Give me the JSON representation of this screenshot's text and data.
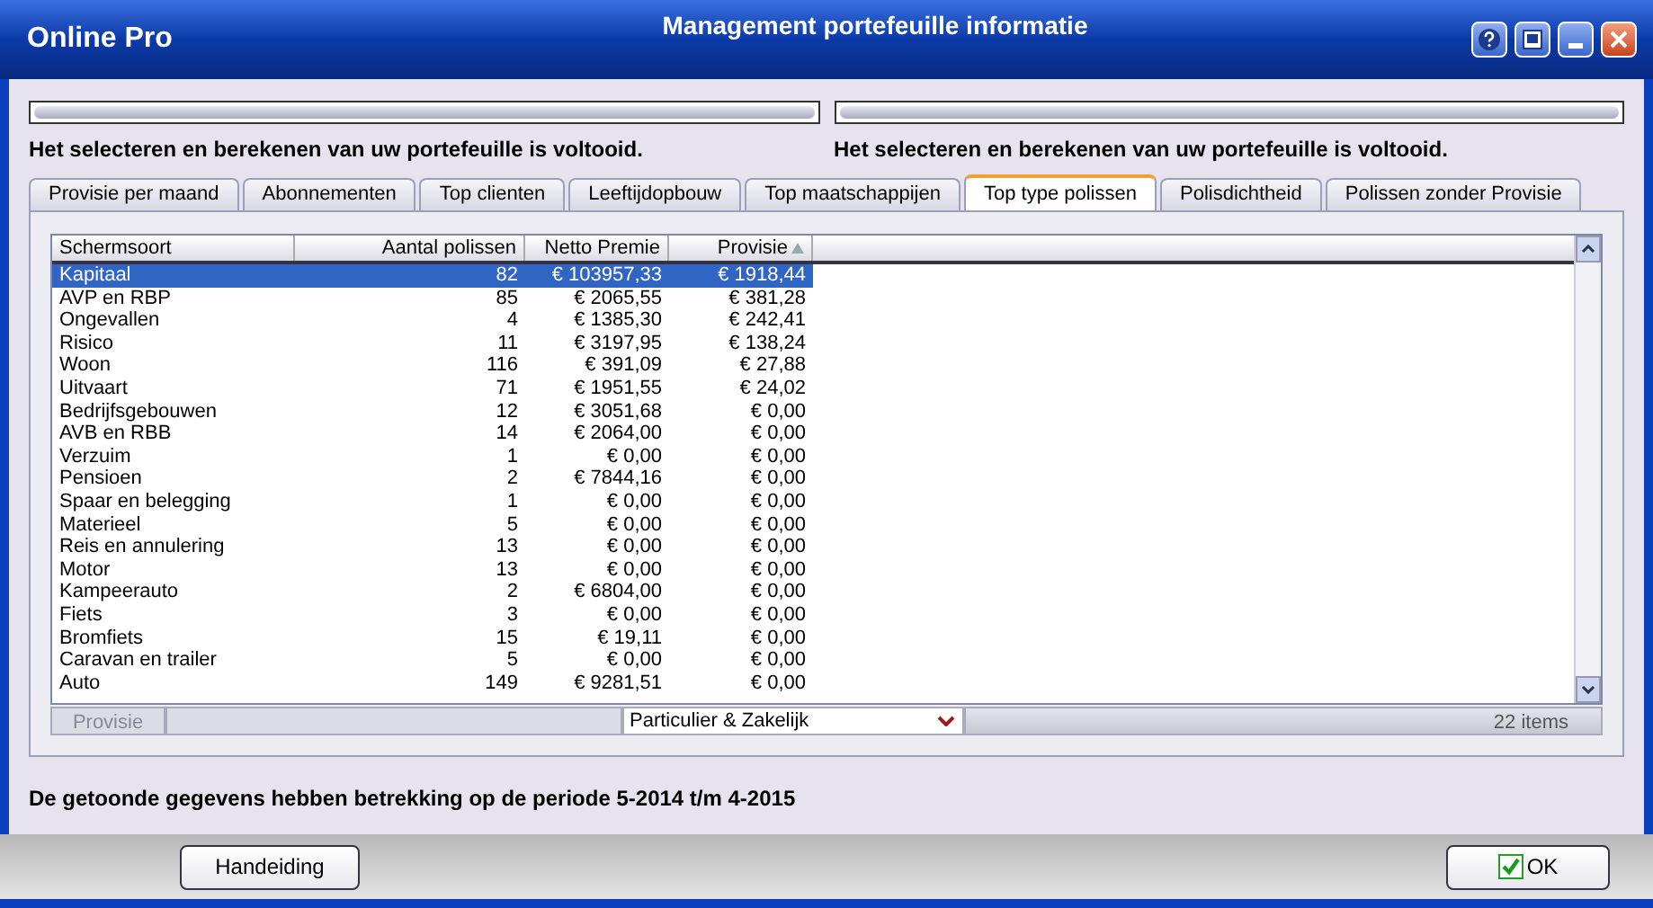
{
  "window": {
    "app_name": "Online Pro",
    "title": "Management portefeuille informatie"
  },
  "progress": [
    {
      "level": 1,
      "message": "Het selecteren en berekenen van uw portefeuille is voltooid."
    },
    {
      "level": 1,
      "message": "Het selecteren en berekenen van uw portefeuille is voltooid."
    }
  ],
  "tabs": [
    {
      "label": "Provisie per maand",
      "selected": false
    },
    {
      "label": "Abonnementen",
      "selected": false
    },
    {
      "label": "Top clienten",
      "selected": false
    },
    {
      "label": "Leeftijdopbouw",
      "selected": false
    },
    {
      "label": "Top maatschappijen",
      "selected": false
    },
    {
      "label": "Top type polissen",
      "selected": true
    },
    {
      "label": "Polisdichtheid",
      "selected": false
    },
    {
      "label": "Polissen zonder Provisie",
      "selected": false
    }
  ],
  "table": {
    "columns": [
      "Schermsoort",
      "Aantal polissen",
      "Netto Premie",
      "Provisie"
    ],
    "rows": [
      {
        "cells": [
          "Kapitaal",
          "82",
          "€ 103957,33",
          "€ 1918,44"
        ],
        "selected": true
      },
      {
        "cells": [
          "AVP en RBP",
          "85",
          "€ 2065,55",
          "€ 381,28"
        ],
        "selected": false
      },
      {
        "cells": [
          "Ongevallen",
          "4",
          "€ 1385,30",
          "€ 242,41"
        ],
        "selected": false
      },
      {
        "cells": [
          "Risico",
          "11",
          "€ 3197,95",
          "€ 138,24"
        ],
        "selected": false
      },
      {
        "cells": [
          "Woon",
          "116",
          "€ 391,09",
          "€ 27,88"
        ],
        "selected": false
      },
      {
        "cells": [
          "Uitvaart",
          "71",
          "€ 1951,55",
          "€ 24,02"
        ],
        "selected": false
      },
      {
        "cells": [
          "Bedrijfsgebouwen",
          "12",
          "€ 3051,68",
          "€ 0,00"
        ],
        "selected": false
      },
      {
        "cells": [
          "AVB en RBB",
          "14",
          "€ 2064,00",
          "€ 0,00"
        ],
        "selected": false
      },
      {
        "cells": [
          "Verzuim",
          "1",
          "€ 0,00",
          "€ 0,00"
        ],
        "selected": false
      },
      {
        "cells": [
          "Pensioen",
          "2",
          "€ 7844,16",
          "€ 0,00"
        ],
        "selected": false
      },
      {
        "cells": [
          "Spaar en belegging",
          "1",
          "€ 0,00",
          "€ 0,00"
        ],
        "selected": false
      },
      {
        "cells": [
          "Materieel",
          "5",
          "€ 0,00",
          "€ 0,00"
        ],
        "selected": false
      },
      {
        "cells": [
          "Reis en annulering",
          "13",
          "€ 0,00",
          "€ 0,00"
        ],
        "selected": false
      },
      {
        "cells": [
          "Motor",
          "13",
          "€ 0,00",
          "€ 0,00"
        ],
        "selected": false
      },
      {
        "cells": [
          "Kampeerauto",
          "2",
          "€ 6804,00",
          "€ 0,00"
        ],
        "selected": false
      },
      {
        "cells": [
          "Fiets",
          "3",
          "€ 0,00",
          "€ 0,00"
        ],
        "selected": false
      },
      {
        "cells": [
          "Bromfiets",
          "15",
          "€ 19,11",
          "€ 0,00"
        ],
        "selected": false
      },
      {
        "cells": [
          "Caravan en trailer",
          "5",
          "€ 0,00",
          "€ 0,00"
        ],
        "selected": false
      },
      {
        "cells": [
          "Auto",
          "149",
          "€ 9281,51",
          "€ 0,00"
        ],
        "selected": false
      }
    ]
  },
  "table_footer": {
    "button": "Provisie",
    "filter": "Particulier & Zakelijk",
    "count": "22 items"
  },
  "period_note": "De getoonde gegevens hebben betrekking op de periode 5-2014 t/m 4-2015",
  "buttons": {
    "manual": "Handeiding",
    "ok": "OK"
  }
}
